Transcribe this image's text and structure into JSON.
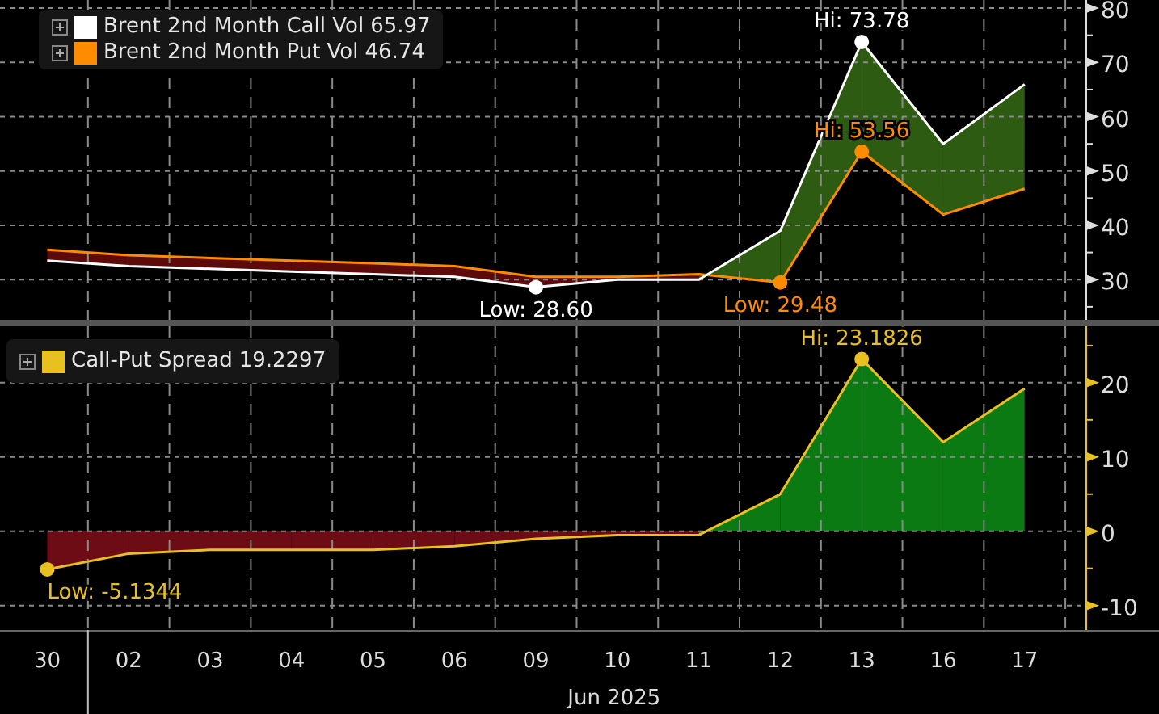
{
  "top_chart": {
    "legend": [
      {
        "value": "65.97"
      },
      {
        "value": "46.74"
      }
    ],
    "chart_data": {
      "type": "line",
      "grid": true,
      "series": [
        {
          "name": "Brent 2nd Month Call Vol",
          "color": "#ffffff",
          "values": [
            33.5,
            32.5,
            32,
            31.5,
            31,
            30.5,
            28.6,
            30,
            30,
            39,
            73.78,
            55,
            65.97
          ]
        },
        {
          "name": "Brent 2nd Month Put Vol",
          "color": "#ff8c00",
          "values": [
            35.5,
            34.5,
            34,
            33.5,
            33,
            32.5,
            30.5,
            30.5,
            31,
            29.48,
            53.56,
            42,
            46.74
          ]
        }
      ],
      "ylim": [
        22.6,
        81.5
      ],
      "yticks": [
        30,
        40,
        50,
        60,
        70,
        80
      ],
      "annotations": [
        "Hi: 73.78",
        "Hi: 53.56",
        "Low: 28.60",
        "Low: 29.48"
      ]
    }
  },
  "bottom_chart": {
    "legend": [
      {
        "value": "19.2297"
      }
    ],
    "chart_data": {
      "type": "line",
      "grid": true,
      "categories": [
        "30",
        "02",
        "03",
        "04",
        "05",
        "06",
        "09",
        "10",
        "11",
        "12",
        "13",
        "16",
        "17"
      ],
      "xlabel": "Jun 2025",
      "series": [
        {
          "name": "Call-Put Spread",
          "color": "#e8c020",
          "values": [
            -5.1344,
            -3,
            -2.5,
            -2.5,
            -2.5,
            -2,
            -1,
            -0.5,
            -0.5,
            5,
            23.1826,
            12,
            19.2297
          ]
        }
      ],
      "ylim": [
        -13.3,
        27.6
      ],
      "yticks": [
        -10,
        0,
        10,
        20
      ],
      "annotations": [
        "Hi: 23.1826",
        "Low: -5.1344"
      ]
    }
  }
}
